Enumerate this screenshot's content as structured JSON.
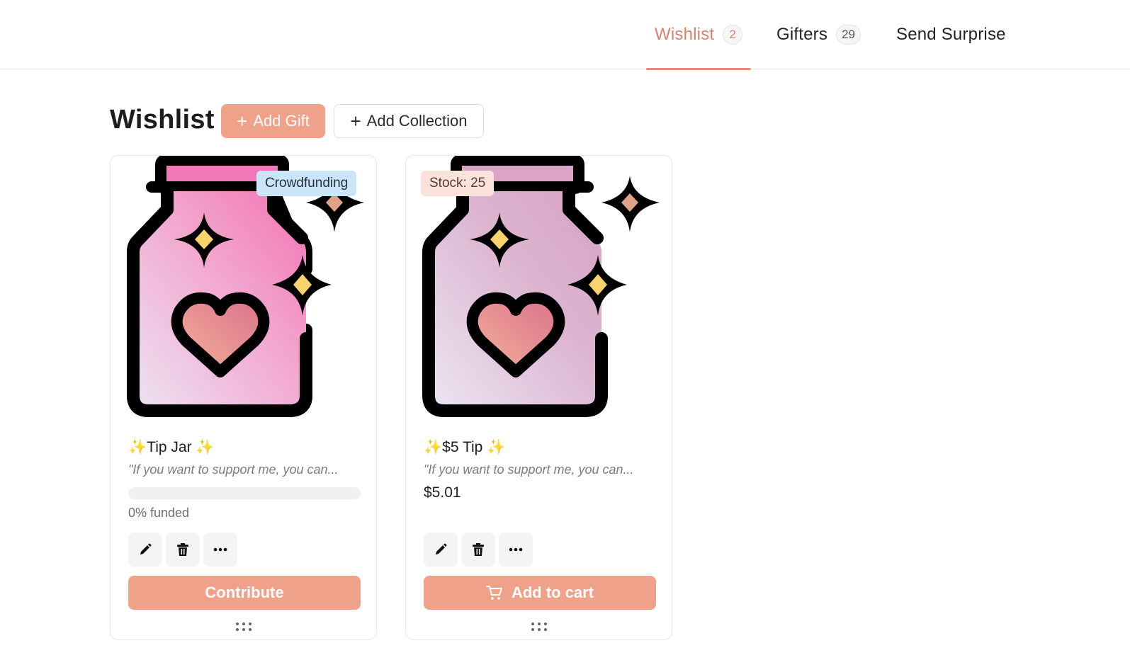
{
  "nav": {
    "tabs": [
      {
        "label": "Wishlist",
        "count": "2"
      },
      {
        "label": "Gifters",
        "count": "29"
      },
      {
        "label": "Send Surprise"
      }
    ],
    "active_tab": "Wishlist",
    "accent_color": "#e08e76"
  },
  "header": {
    "title": "Wishlist",
    "add_gift_label": "Add Gift",
    "add_collection_label": "Add Collection"
  },
  "cards": [
    {
      "badge": "Crowdfunding",
      "title_text": "Tip Jar",
      "description": "\"If you want to support me, you can...",
      "funded_fraction": 0,
      "funded_label": "0% funded",
      "button_label": "Contribute",
      "image_icon": "tip-jar-icon"
    },
    {
      "badge": "Stock: 25",
      "title_text": "$5 Tip",
      "description": "\"If you want to support me, you can...",
      "price": "$5.01",
      "button_label": "Add to cart",
      "image_icon": "tip-jar-icon"
    }
  ],
  "icons": {
    "edit": "pencil-icon",
    "delete": "trash-icon",
    "more": "more-horizontal-icon",
    "cart": "cart-icon",
    "drag": "drag-handle-icon",
    "sparkle": "sparkles-emoji"
  },
  "colors": {
    "primary_button": "#f0a18a",
    "crowdfunding_badge": "#c9e5f7",
    "stock_badge": "#fbe3dc"
  }
}
